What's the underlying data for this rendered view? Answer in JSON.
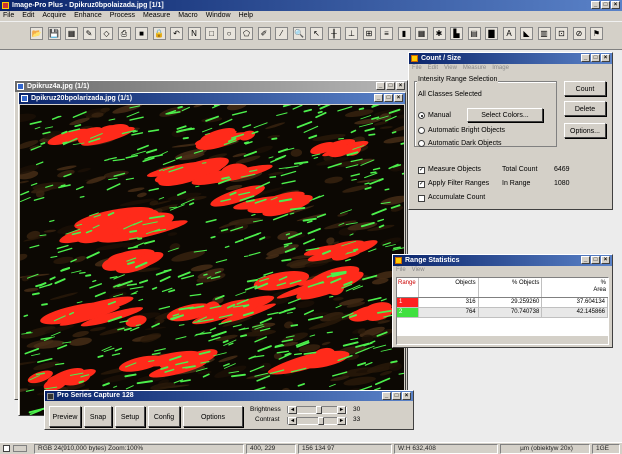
{
  "app": {
    "title": "Image-Pro Plus - Dpikruz0bpolaizada.jpg [1/1]",
    "menu": [
      "File",
      "Edit",
      "Acquire",
      "Enhance",
      "Process",
      "Measure",
      "Macro",
      "Window",
      "Help"
    ]
  },
  "toolbar": {
    "icons": [
      "open-icon",
      "save-icon",
      "grid-icon",
      "pen-icon",
      "brush-icon",
      "print-icon",
      "red-square-icon",
      "lock-icon",
      "undo-icon",
      "new-icon",
      "rectangle-icon",
      "ellipse-icon",
      "polygon-icon",
      "freehand-icon",
      "line-icon",
      "magnifier-icon",
      "pointer-icon",
      "measure-icon",
      "calibrate-icon",
      "table-icon",
      "filter-icon",
      "histogram-icon",
      "grid2-icon",
      "color-icon",
      "bars-icon",
      "gray-icon",
      "chart-icon",
      "analysis-icon",
      "count-icon",
      "layers-icon",
      "report-icon",
      "export-icon",
      "macro-icon"
    ]
  },
  "bg_window": {
    "title": "Dpikruz4a.jpg (1/1)"
  },
  "image_window": {
    "title": "Dpikruz20bpolarizada.jpg (1/1)"
  },
  "count_size": {
    "title": "Count / Size",
    "menu": [
      "File",
      "Edit",
      "View",
      "Measure",
      "Image"
    ],
    "group_label": "Intensity Range Selection",
    "all_classes": "All Classes Selected",
    "radio_manual": "Manual",
    "select_colors": "Select Colors...",
    "radio_bright": "Automatic Bright Objects",
    "radio_dark": "Automatic Dark Objects",
    "chk_measure": "Measure Objects",
    "chk_filter": "Apply Filter Ranges",
    "chk_accumulate": "Accumulate Count",
    "total_count_label": "Total Count",
    "total_count_value": "6469",
    "in_range_label": "In Range",
    "in_range_value": "1080",
    "btn_count": "Count",
    "btn_delete": "Delete",
    "btn_options": "Options..."
  },
  "range_stats": {
    "title": "Range Statistics",
    "menu": [
      "File",
      "View"
    ],
    "headers": [
      "Range",
      "Objects",
      "% Objects",
      "%\nArea"
    ],
    "rows": [
      {
        "range": "1",
        "objects": "316",
        "pct_objects": "29.259260",
        "pct_area": "37.604134",
        "color": "#ff2020"
      },
      {
        "range": "2",
        "objects": "764",
        "pct_objects": "70.740738",
        "pct_area": "42.145866",
        "color": "#40e040"
      }
    ]
  },
  "capture": {
    "title": "Pro Series Capture 128",
    "buttons": [
      "Preview",
      "Snap",
      "Setup",
      "Config",
      "Options"
    ],
    "brightness_label": "Brightness",
    "contrast_label": "Contrast",
    "brightness_value": "30",
    "contrast_value": "33"
  },
  "status": {
    "mode": "RGB 24(910,000 bytes) Zoom:100%",
    "coords": "400, 229",
    "rgb": "156 134 97",
    "wh": "W:H 632,408",
    "calib": "µm (obiektyw 20x)",
    "scale": "1GE"
  },
  "colors": {
    "red": "#ff2a1a",
    "green": "#4cf04c",
    "title_blue": "#0a246a"
  }
}
